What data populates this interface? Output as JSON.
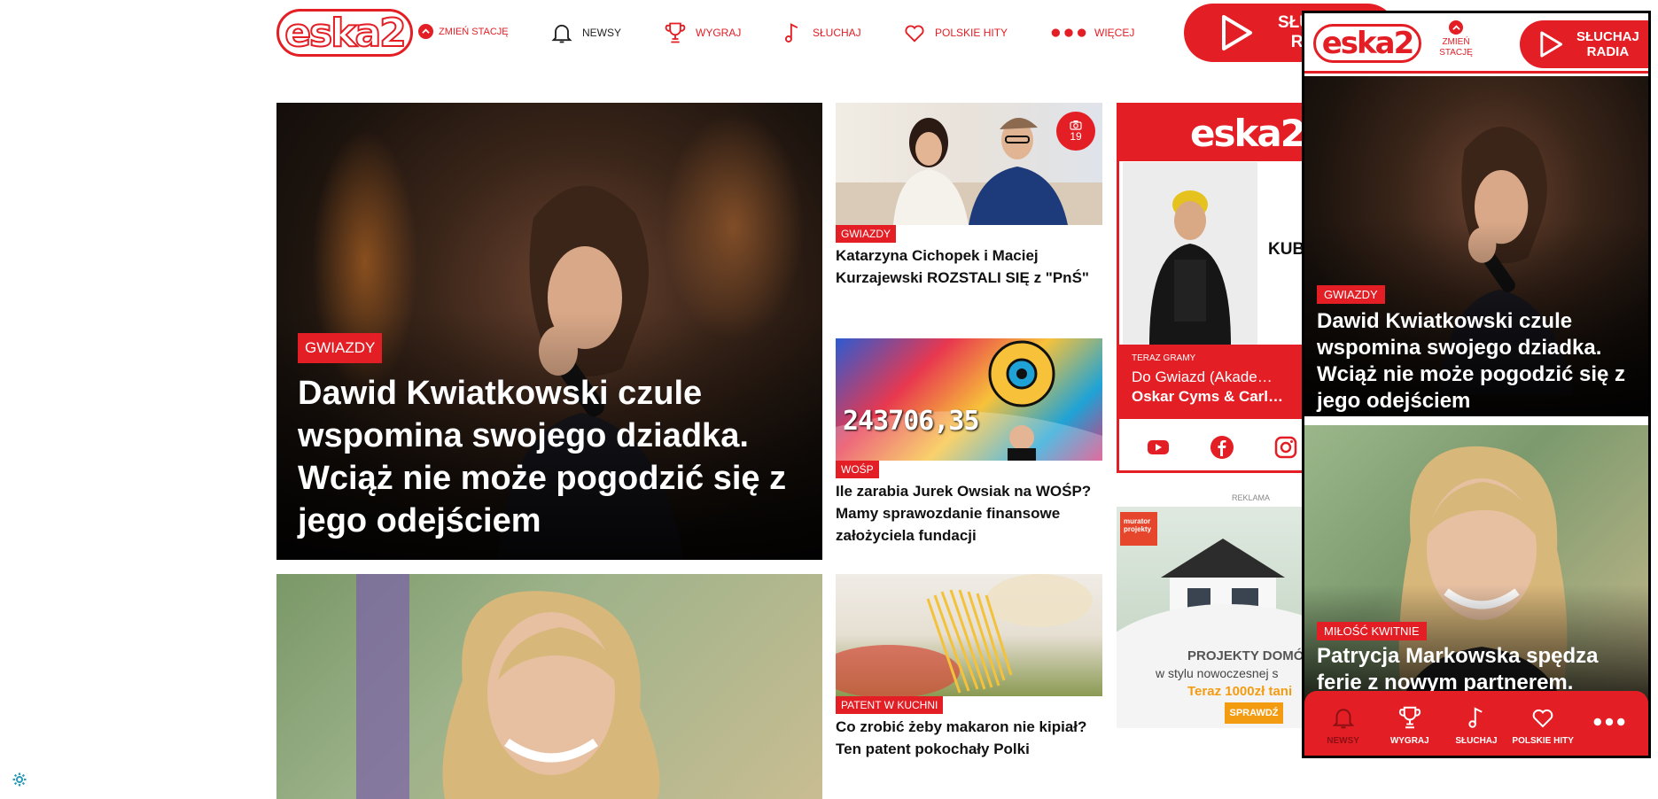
{
  "header": {
    "logo_text": "eska2",
    "change_station": "ZMIEŃ STACJĘ",
    "nav": [
      {
        "label": "NEWSY",
        "icon": "bell-icon"
      },
      {
        "label": "WYGRAJ",
        "icon": "trophy-icon"
      },
      {
        "label": "SŁUCHAJ",
        "icon": "music-note-icon"
      },
      {
        "label": "POLSKIE HITY",
        "icon": "heart-icon"
      },
      {
        "label": "WIĘCEJ",
        "icon": "dots-icon"
      }
    ],
    "listen_line1": "SŁUCHAJ",
    "listen_line2": "RADIA"
  },
  "hero": {
    "tag": "GWIAZDY",
    "title": "Dawid Kwiatkowski czule wspomina swojego dziadka. Wciąż nie może pogodzić się z jego odejściem"
  },
  "articles": [
    {
      "tag": "GWIAZDY",
      "title": "Katarzyna Cichopek i Maciej Kurzajewski ROZSTALI SIĘ z \"PnŚ\"",
      "photo_count": "19"
    },
    {
      "tag": "WOŚP",
      "title": "Ile zarabia Jurek Owsiak na WOŚP? Mamy sprawozdanie finansowe założyciela fundacji",
      "counter": "243706,35"
    },
    {
      "tag": "PATENT W KUCHNI",
      "title": "Co zrobić żeby makaron nie kipiał? Ten patent pokochały Polki"
    }
  ],
  "radio": {
    "logo": "eska2",
    "host": "KUB",
    "now_label": "TERAZ GRAMY",
    "now_title": "Do Gwiazd (Akade…",
    "now_artist": "Oskar Cyms & Carl…",
    "socials": [
      "youtube-icon",
      "facebook-icon",
      "instagram-icon"
    ]
  },
  "ad": {
    "label": "REKLAMA",
    "brand": "murator projekty",
    "line1": "PROJEKTY DOMÓ",
    "line2": "w stylu nowoczesnej s",
    "line3": "Teraz 1000zł tani",
    "cta": "SPRAWDŹ"
  },
  "mobile": {
    "logo": "eska2",
    "change_station_line1": "ZMIEŃ",
    "change_station_line2": "STACJĘ",
    "listen_line1": "SŁUCHAJ",
    "listen_line2": "RADIA",
    "hero_tag": "GWIAZDY",
    "hero_title": "Dawid Kwiatkowski czule wspomina swojego dziadka. Wciąż nie może pogodzić się z jego odejściem",
    "card2_tag": "MIŁOŚĆ KWITNIE",
    "card2_title": "Patrycja Markowska spędza ferie z nowym partnerem. Pierwszy raz pokazała",
    "tabs": [
      {
        "label": "NEWSY",
        "icon": "bell-icon"
      },
      {
        "label": "WYGRAJ",
        "icon": "trophy-icon"
      },
      {
        "label": "SŁUCHAJ",
        "icon": "music-note-icon"
      },
      {
        "label": "POLSKIE HITY",
        "icon": "heart-icon"
      },
      {
        "label": "",
        "icon": "dots-icon"
      }
    ]
  },
  "colors": {
    "brand": "#e31e24",
    "text": "#111111",
    "ad_accent": "#f39c12"
  }
}
